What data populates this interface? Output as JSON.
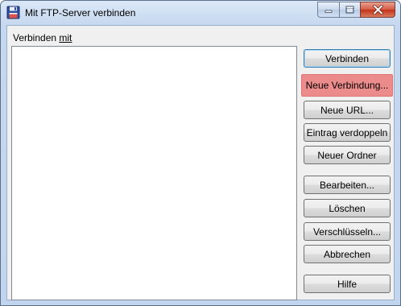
{
  "window": {
    "title": "Mit FTP-Server verbinden",
    "icon": "floppy-disk-icon",
    "controls": {
      "minimize_icon": "minimize-icon",
      "maximize_icon": "maximize-icon",
      "close_icon": "close-icon"
    }
  },
  "form": {
    "connect_label_prefix": "Verbinden ",
    "connect_label_mnemonic": "mit"
  },
  "buttons": {
    "connect": "Verbinden",
    "new_connection": "Neue Verbindung...",
    "new_url": "Neue URL...",
    "duplicate_entry": "Eintrag verdoppeln",
    "new_folder": "Neuer Ordner",
    "edit": "Bearbeiten...",
    "delete": "Löschen",
    "encrypt": "Verschlüsseln...",
    "cancel": "Abbrechen",
    "help": "Hilfe"
  },
  "colors": {
    "highlight": "#ec8b8b",
    "close_button": "#c3321a"
  }
}
